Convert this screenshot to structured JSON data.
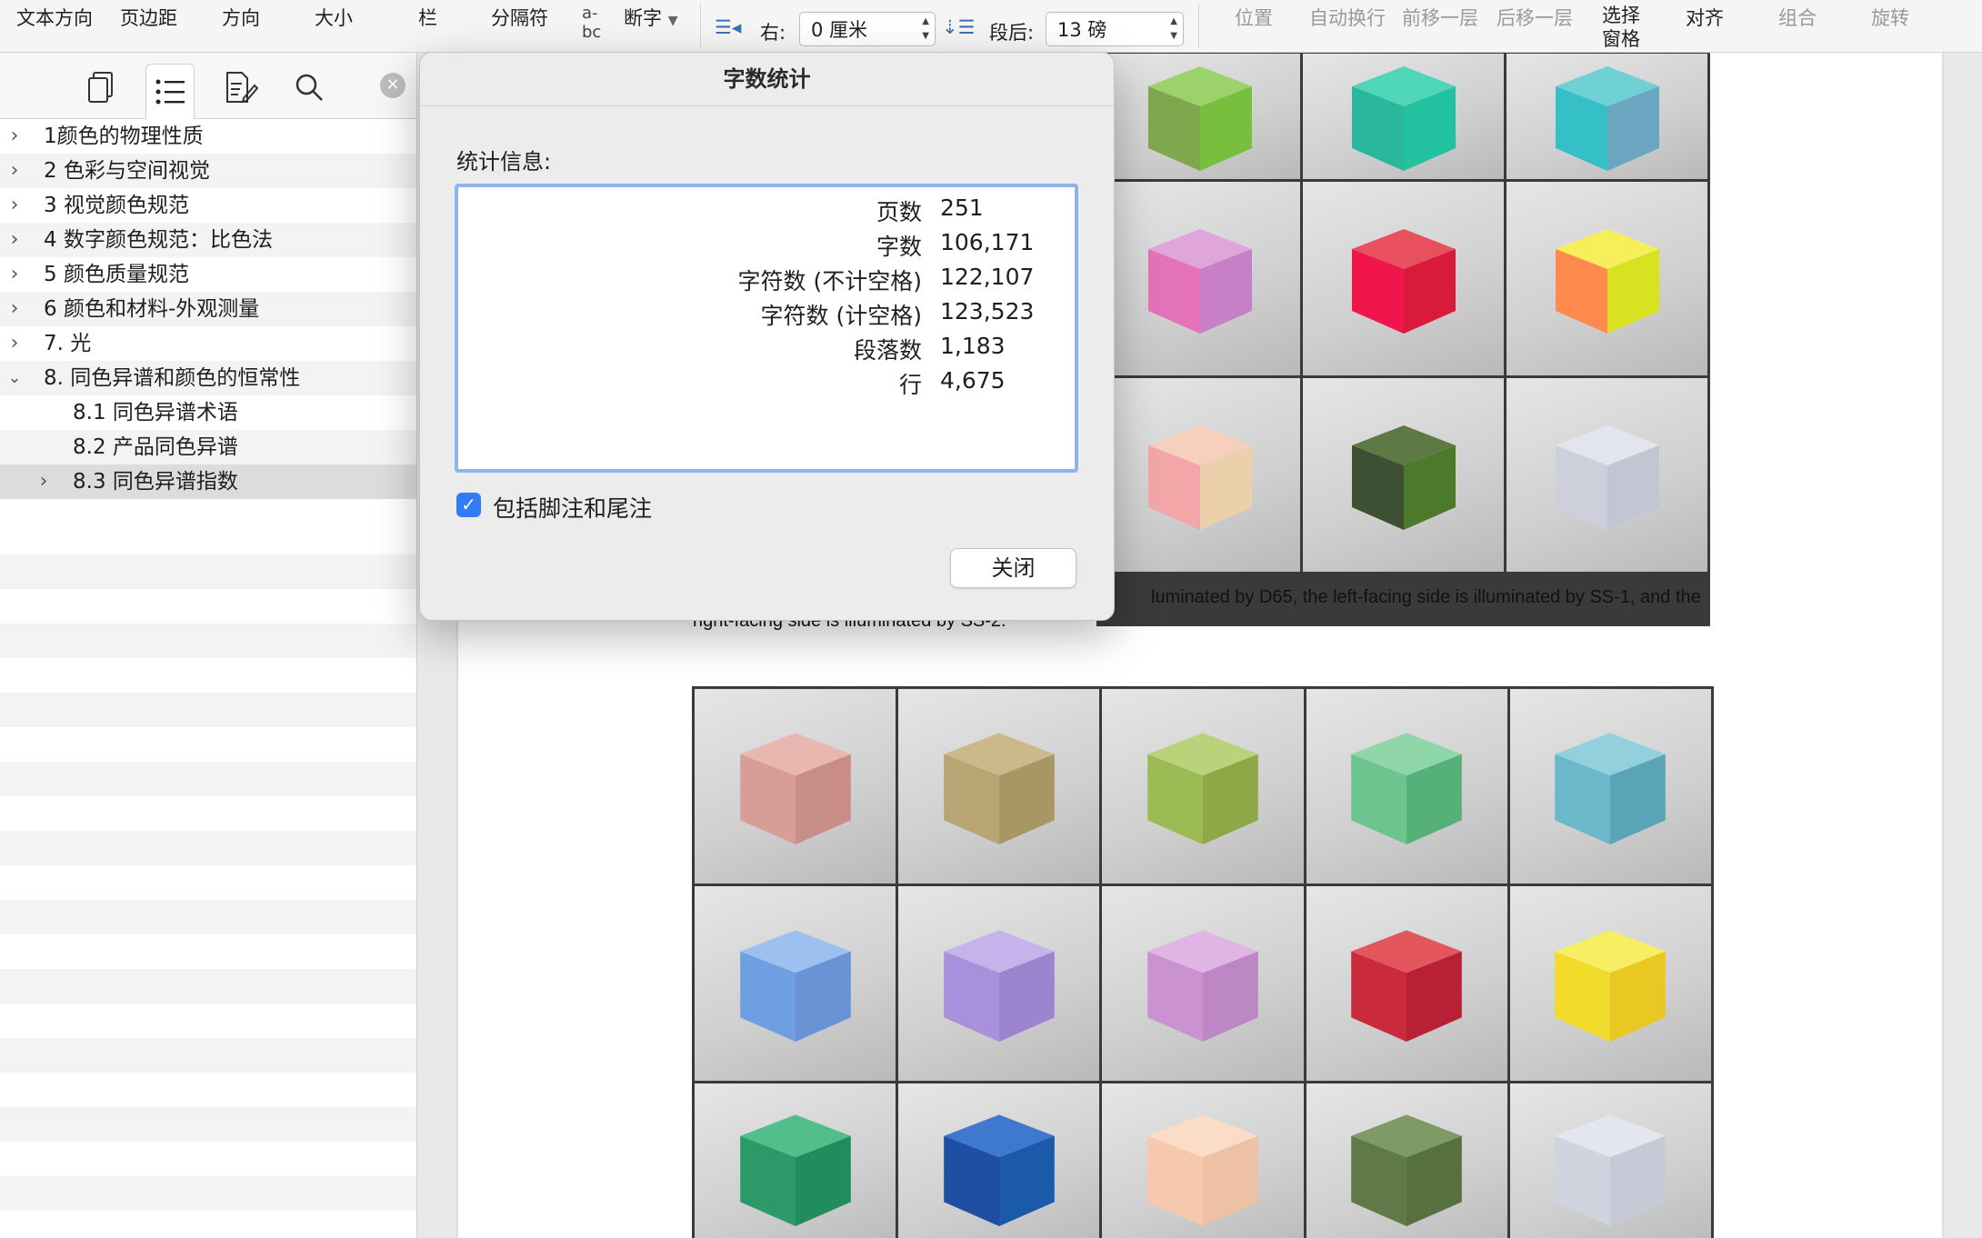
{
  "ribbon": {
    "text_direction": "文本方向",
    "margins": "页边距",
    "orientation": "方向",
    "size": "大小",
    "columns": "栏",
    "breaks": "分隔符",
    "hyphenation": "断字",
    "indent_right_label": "右:",
    "indent_right_value": "0 厘米",
    "spacing_after_label": "段后:",
    "spacing_after_value": "13 磅",
    "position": "位置",
    "wrap_text": "自动换行",
    "bring_forward": "前移一层",
    "send_backward": "后移一层",
    "selection_pane_1": "选择",
    "selection_pane_2": "窗格",
    "align": "对齐",
    "group": "组合",
    "rotate": "旋转"
  },
  "sidebar": {
    "items": [
      {
        "label": "1颜色的物理性质",
        "expanded": false
      },
      {
        "label": "2 色彩与空间视觉",
        "expanded": false
      },
      {
        "label": "3 视觉颜色规范",
        "expanded": false
      },
      {
        "label": "4 数字颜色规范：比色法",
        "expanded": false
      },
      {
        "label": "5 颜色质量规范",
        "expanded": false
      },
      {
        "label": "6 颜色和材料-外观测量",
        "expanded": false
      },
      {
        "label": "7. 光",
        "expanded": false
      },
      {
        "label": "8. 同色异谱和颜色的恒常性",
        "expanded": true
      },
      {
        "label": "8.1 同色异谱术语",
        "expanded": false
      },
      {
        "label": "8.2 产品同色异谱",
        "expanded": false
      },
      {
        "label": "8.3 同色异谱指数",
        "expanded": false
      }
    ]
  },
  "document": {
    "caption_line1": "luminated by D65, the left-facing side is illuminated by SS-1, and the",
    "caption_line2": "right-facing side is illuminated by SS-2."
  },
  "dialog": {
    "title": "字数统计",
    "section_label": "统计信息:",
    "stats": [
      {
        "label": "页数",
        "value": "251"
      },
      {
        "label": "字数",
        "value": "106,171"
      },
      {
        "label": "字符数 (不计空格)",
        "value": "122,107"
      },
      {
        "label": "字符数 (计空格)",
        "value": "123,523"
      },
      {
        "label": "段落数",
        "value": "1,183"
      },
      {
        "label": "行",
        "value": "4,675"
      }
    ],
    "include_footnotes_label": "包括脚注和尾注",
    "include_footnotes_checked": true,
    "close_button": "关闭"
  },
  "colors": {
    "accent": "#2f7cf6",
    "focus_ring": "#8fb4ec",
    "para_mark": "#3b7fd9"
  }
}
